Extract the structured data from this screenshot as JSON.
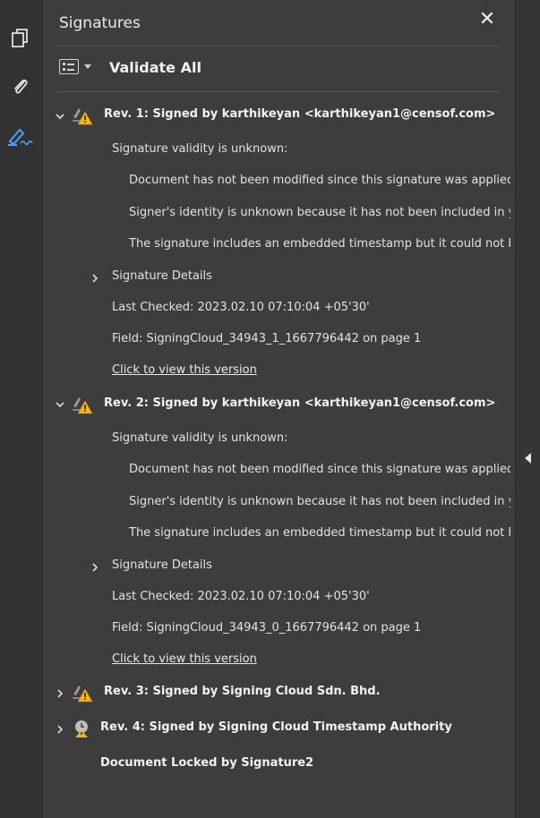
{
  "panel": {
    "title": "Signatures",
    "validate_all": "Validate All"
  },
  "revisions": [
    {
      "header": "Rev. 1: Signed by karthikeyan <karthikeyan1@censof.com>",
      "validity": "Signature validity is unknown:",
      "details": [
        "Document has not been modified since this signature was applied",
        "Signer's identity is unknown because it has not been included in your",
        "The signature includes an embedded timestamp but it could not be v"
      ],
      "sig_details": "Signature Details",
      "last_checked": "Last Checked: 2023.02.10 07:10:04 +05'30'",
      "field": "Field: SigningCloud_34943_1_1667796442 on page 1",
      "view_link": "Click to view this version"
    },
    {
      "header": "Rev. 2: Signed by karthikeyan <karthikeyan1@censof.com>",
      "validity": "Signature validity is unknown:",
      "details": [
        "Document has not been modified since this signature was applied",
        "Signer's identity is unknown because it has not been included in your",
        "The signature includes an embedded timestamp but it could not be v"
      ],
      "sig_details": "Signature Details",
      "last_checked": "Last Checked: 2023.02.10 07:10:04 +05'30'",
      "field": "Field: SigningCloud_34943_0_1667796442 on page 1",
      "view_link": "Click to view this version"
    },
    {
      "header": "Rev. 3: Signed by Signing Cloud Sdn. Bhd."
    },
    {
      "header": "Rev. 4: Signed by Signing Cloud Timestamp Authority"
    }
  ],
  "locked_text": "Document Locked by Signature2",
  "sidebar_icons": [
    "pages-icon",
    "attachment-icon",
    "signature-pen-icon"
  ],
  "colors": {
    "panel_bg": "#3d3d3d",
    "warn": "#f2b61b",
    "accent_blue": "#4aa3f0"
  }
}
